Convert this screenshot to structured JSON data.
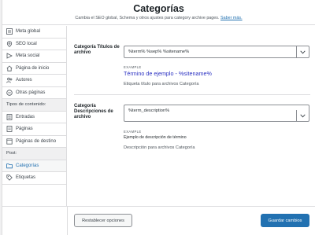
{
  "header": {
    "title": "Categorías",
    "description": "Cambia el SEO global, Schema y otros ajustes para category archive pages.",
    "link_label": "Saber más."
  },
  "sidebar": {
    "items": [
      {
        "label": "Meta global",
        "icon": "sliders-icon"
      },
      {
        "label": "SEO local",
        "icon": "location-pin-icon"
      },
      {
        "label": "Meta social",
        "icon": "share-icon"
      },
      {
        "label": "Página de inicio",
        "icon": "home-icon"
      },
      {
        "label": "Autores",
        "icon": "users-icon"
      },
      {
        "label": "Otras páginas",
        "icon": "pages-icon"
      }
    ],
    "section_content": "Tipos de contenido:",
    "content_items": [
      {
        "label": "Entradas",
        "icon": "post-icon"
      },
      {
        "label": "Páginas",
        "icon": "page-icon"
      },
      {
        "label": "Páginas de destino",
        "icon": "landing-icon"
      }
    ],
    "section_post": "Post:",
    "post_items": [
      {
        "label": "Categorías",
        "icon": "folder-icon",
        "active": true
      },
      {
        "label": "Etiquetas",
        "icon": "tag-icon"
      }
    ]
  },
  "fields": {
    "title": {
      "label": "Categoría Títulos de archivo",
      "value": "%term% %sep% %sitename%",
      "example_label": "EXAMPLE",
      "example_value": "Término de ejemplo - %sitename%",
      "help": "Etiqueta título para archivos Categoría"
    },
    "description": {
      "label": "Categoría Descripciones de archivo",
      "value": "%term_description%",
      "example_label": "EXAMPLE",
      "example_value": "Ejemplo de descripción de término",
      "help": "Descripción para archivos Categoría"
    }
  },
  "footer": {
    "reset_label": "Restablecer opciones",
    "save_label": "Guardar cambios"
  },
  "colors": {
    "accent": "#2271b1",
    "example_blue": "#2b31c2"
  }
}
